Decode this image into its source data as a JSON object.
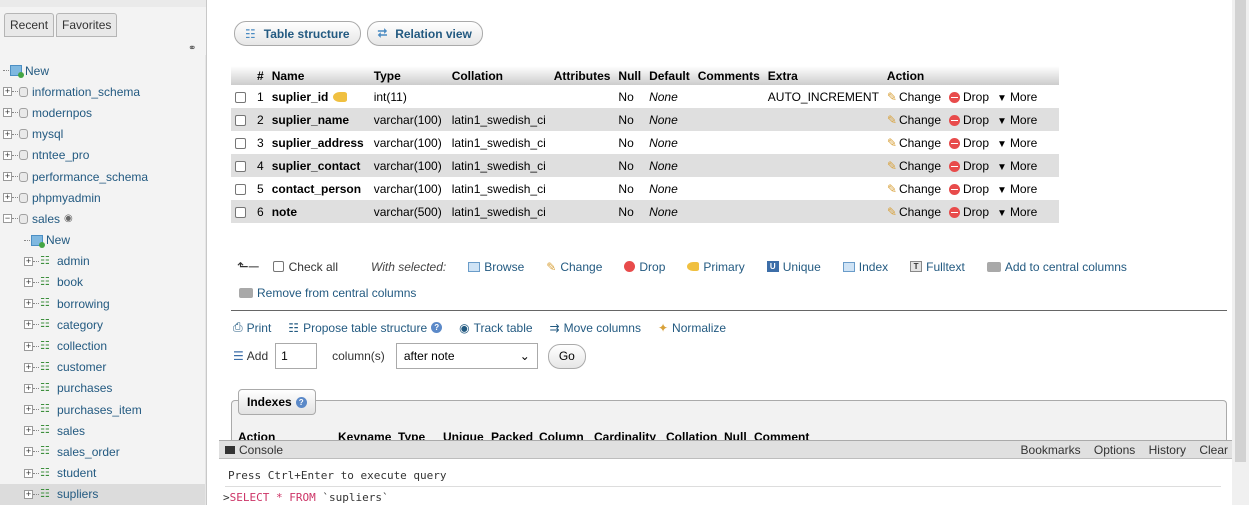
{
  "nav": {
    "tabs": [
      "Recent",
      "Favorites"
    ],
    "tree": [
      {
        "label": "New",
        "type": "new",
        "level": 0
      },
      {
        "label": "information_schema",
        "type": "db",
        "level": 0
      },
      {
        "label": "modernpos",
        "type": "db",
        "level": 0
      },
      {
        "label": "mysql",
        "type": "db",
        "level": 0
      },
      {
        "label": "ntntee_pro",
        "type": "db",
        "level": 0
      },
      {
        "label": "performance_schema",
        "type": "db",
        "level": 0
      },
      {
        "label": "phpmyadmin",
        "type": "db",
        "level": 0
      },
      {
        "label": "sales",
        "type": "db-open",
        "level": 0
      },
      {
        "label": "New",
        "type": "new",
        "level": 1
      },
      {
        "label": "admin",
        "type": "table",
        "level": 1
      },
      {
        "label": "book",
        "type": "table",
        "level": 1
      },
      {
        "label": "borrowing",
        "type": "table",
        "level": 1
      },
      {
        "label": "category",
        "type": "table",
        "level": 1
      },
      {
        "label": "collection",
        "type": "table",
        "level": 1
      },
      {
        "label": "customer",
        "type": "table",
        "level": 1
      },
      {
        "label": "purchases",
        "type": "table",
        "level": 1
      },
      {
        "label": "purchases_item",
        "type": "table",
        "level": 1
      },
      {
        "label": "sales",
        "type": "table",
        "level": 1
      },
      {
        "label": "sales_order",
        "type": "table",
        "level": 1
      },
      {
        "label": "student",
        "type": "table",
        "level": 1
      },
      {
        "label": "supliers",
        "type": "table",
        "level": 1,
        "selected": true
      }
    ]
  },
  "top_buttons": {
    "table_structure": "Table structure",
    "relation_view": "Relation view"
  },
  "structure": {
    "headers": [
      "",
      "#",
      "Name",
      "Type",
      "Collation",
      "Attributes",
      "Null",
      "Default",
      "Comments",
      "Extra",
      "Action"
    ],
    "rows": [
      {
        "num": "1",
        "name": "suplier_id",
        "type": "int(11)",
        "collation": "",
        "attributes": "",
        "null": "No",
        "default": "None",
        "comments": "",
        "extra": "AUTO_INCREMENT",
        "primary": true
      },
      {
        "num": "2",
        "name": "suplier_name",
        "type": "varchar(100)",
        "collation": "latin1_swedish_ci",
        "attributes": "",
        "null": "No",
        "default": "None",
        "comments": "",
        "extra": ""
      },
      {
        "num": "3",
        "name": "suplier_address",
        "type": "varchar(100)",
        "collation": "latin1_swedish_ci",
        "attributes": "",
        "null": "No",
        "default": "None",
        "comments": "",
        "extra": ""
      },
      {
        "num": "4",
        "name": "suplier_contact",
        "type": "varchar(100)",
        "collation": "latin1_swedish_ci",
        "attributes": "",
        "null": "No",
        "default": "None",
        "comments": "",
        "extra": ""
      },
      {
        "num": "5",
        "name": "contact_person",
        "type": "varchar(100)",
        "collation": "latin1_swedish_ci",
        "attributes": "",
        "null": "No",
        "default": "None",
        "comments": "",
        "extra": ""
      },
      {
        "num": "6",
        "name": "note",
        "type": "varchar(500)",
        "collation": "latin1_swedish_ci",
        "attributes": "",
        "null": "No",
        "default": "None",
        "comments": "",
        "extra": ""
      }
    ],
    "actions": {
      "change": "Change",
      "drop": "Drop",
      "more": "More"
    }
  },
  "selection_bar": {
    "check_all": "Check all",
    "with_selected": "With selected:",
    "browse": "Browse",
    "change": "Change",
    "drop": "Drop",
    "primary": "Primary",
    "unique": "Unique",
    "index": "Index",
    "fulltext": "Fulltext",
    "add_central": "Add to central columns",
    "remove_central": "Remove from central columns"
  },
  "tools": {
    "print": "Print",
    "propose": "Propose table structure",
    "track": "Track table",
    "move": "Move columns",
    "normalize": "Normalize"
  },
  "add_columns": {
    "label": "Add",
    "count": "1",
    "columns_label": "column(s)",
    "position": "after note",
    "go": "Go"
  },
  "indexes": {
    "title": "Indexes",
    "columns": [
      "Action",
      "Keyname",
      "Type",
      "Unique",
      "Packed",
      "Column",
      "Cardinality",
      "Collation",
      "Null",
      "Comment"
    ]
  },
  "console": {
    "title": "Console",
    "links": [
      "Bookmarks",
      "Options",
      "History",
      "Clear"
    ],
    "hint": "Press Ctrl+Enter to execute query",
    "query_prompt": ">",
    "query_keyword": "SELECT * FROM",
    "query_rest": " `supliers`"
  }
}
